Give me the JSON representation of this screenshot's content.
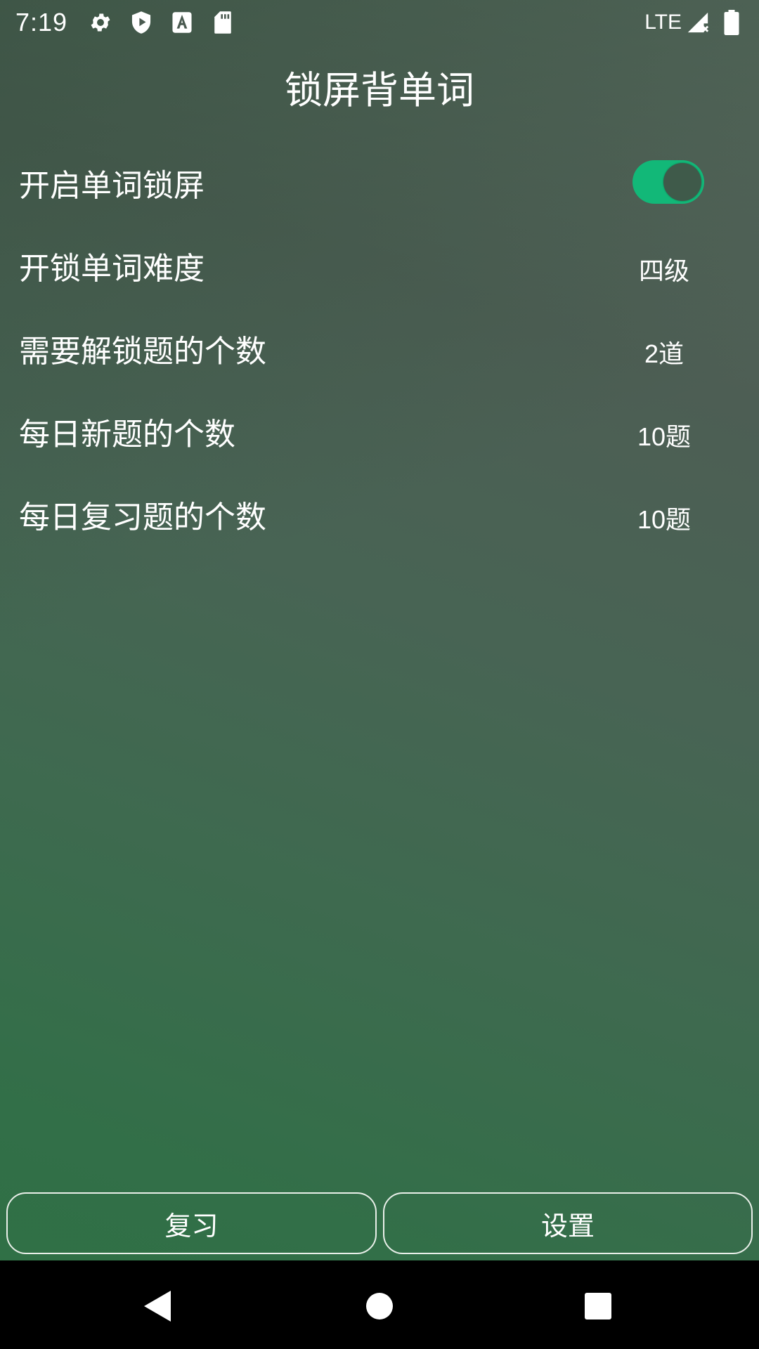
{
  "status_bar": {
    "time": "7:19",
    "icons_left": [
      "gear-icon",
      "shield-icon",
      "font-a-icon",
      "sd-card-icon"
    ],
    "network": "LTE",
    "icons_right": [
      "signal-no-data-icon",
      "battery-icon"
    ]
  },
  "header": {
    "title": "锁屏背单词"
  },
  "settings": {
    "items": [
      {
        "label": "开启单词锁屏",
        "type": "toggle",
        "enabled": true
      },
      {
        "label": "开锁单词难度",
        "value": "四级"
      },
      {
        "label": "需要解锁题的个数",
        "value": "2道"
      },
      {
        "label": "每日新题的个数",
        "value": "10题"
      },
      {
        "label": "每日复习题的个数",
        "value": "10题"
      }
    ]
  },
  "buttons": {
    "review_label": "复习",
    "settings_label": "设置"
  },
  "colors": {
    "toggle_on": "#12b878",
    "background_top": "#4d5e54",
    "background_bottom": "#2e7044",
    "nav_bar": "#000000"
  },
  "nav_bar": {
    "icons": [
      "back-triangle-icon",
      "home-circle-icon",
      "recents-square-icon"
    ]
  }
}
